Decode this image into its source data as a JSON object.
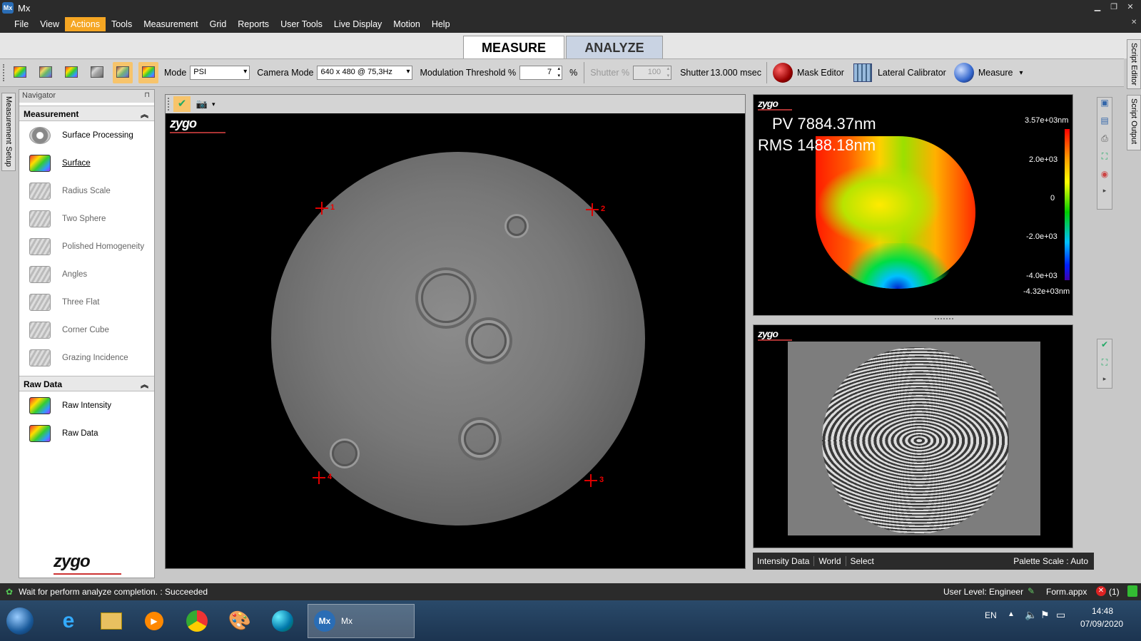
{
  "window": {
    "app_icon_text": "Mx",
    "title": "Mx"
  },
  "menu": [
    "File",
    "View",
    "Actions",
    "Tools",
    "Measurement",
    "Grid",
    "Reports",
    "User Tools",
    "Live Display",
    "Motion",
    "Help"
  ],
  "menu_active": "Actions",
  "mode_tabs": {
    "measure": "MEASURE",
    "analyze": "ANALYZE",
    "active": "MEASURE"
  },
  "toolbar": {
    "mode_label": "Mode",
    "mode_value": "PSI",
    "camera_mode_label": "Camera Mode",
    "camera_mode_value": "640 x 480 @ 75,3Hz",
    "modulation_label": "Modulation Threshold %",
    "modulation_value": "7",
    "percent_label": "%",
    "shutter_pct_label": "Shutter %",
    "shutter_pct_value": "100",
    "shutter_label": "Shutter",
    "shutter_value": "13.000 msec",
    "mask_editor": "Mask Editor",
    "lateral_calibrator": "Lateral Calibrator",
    "measure": "Measure"
  },
  "side_tabs": {
    "left": "Measurement Setup",
    "right_top": "Script Editor",
    "right_bottom": "Script Output"
  },
  "navigator": {
    "title": "Navigator",
    "sections": [
      {
        "name": "Measurement",
        "items": [
          {
            "label": "Surface Processing",
            "icon": "gears-icon",
            "enabled": true
          },
          {
            "label": "Surface",
            "icon": "surface-color-icon",
            "enabled": true,
            "selected": true
          },
          {
            "label": "Radius Scale",
            "icon": "app-gray-icon",
            "enabled": false
          },
          {
            "label": "Two Sphere",
            "icon": "app-gray-icon",
            "enabled": false
          },
          {
            "label": "Polished Homogeneity",
            "icon": "app-gray-icon",
            "enabled": false
          },
          {
            "label": "Angles",
            "icon": "app-gray-icon",
            "enabled": false
          },
          {
            "label": "Three Flat",
            "icon": "app-gray-icon",
            "enabled": false
          },
          {
            "label": "Corner Cube",
            "icon": "app-gray-icon",
            "enabled": false
          },
          {
            "label": "Grazing Incidence",
            "icon": "app-gray-icon",
            "enabled": false
          }
        ]
      },
      {
        "name": "Raw Data",
        "items": [
          {
            "label": "Raw Intensity",
            "icon": "surface-color-icon",
            "enabled": true
          },
          {
            "label": "Raw Data",
            "icon": "surface-color-icon",
            "enabled": true
          }
        ]
      }
    ],
    "logo": "zygo"
  },
  "main_view": {
    "logo": "zygo",
    "markers": [
      "1",
      "2",
      "3",
      "4"
    ]
  },
  "surface_map": {
    "logo": "zygo",
    "pv_label": "PV",
    "pv_value": "7884.37",
    "pv_unit": "nm",
    "rms_label": "RMS",
    "rms_value": "1488.18",
    "rms_unit": "nm",
    "scale": [
      "3.57e+03nm",
      "2.0e+03",
      "0",
      "-2.0e+03",
      "-4.0e+03",
      "-4.32e+03nm"
    ]
  },
  "fringe_view": {
    "logo": "zygo"
  },
  "status_info": {
    "data": "Intensity Data",
    "coords": "World",
    "tool": "Select",
    "palette": "Palette Scale : Auto"
  },
  "statusbar": {
    "message": "Wait for perform analyze completion. : Succeeded",
    "user_level": "User Level: Engineer",
    "file": "Form.appx",
    "errors": "(1)"
  },
  "taskbar": {
    "active_app": "Mx",
    "language": "EN",
    "time": "14:48",
    "date": "07/09/2020"
  },
  "colors": {
    "accent": "#f5a623",
    "titlebar": "#2b2b2b",
    "marker": "#dd0000"
  }
}
